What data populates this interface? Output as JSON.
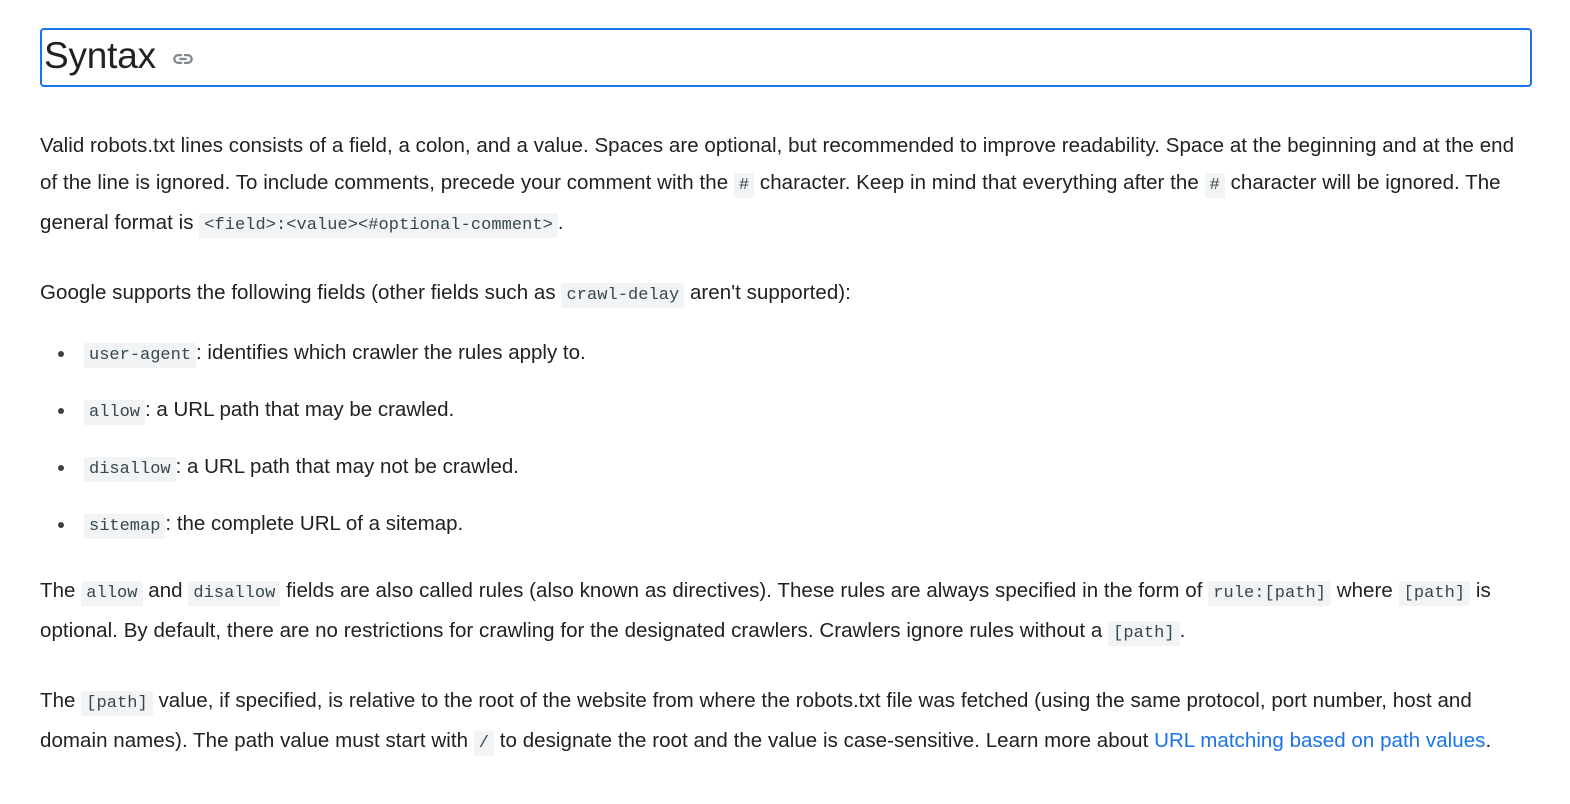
{
  "heading": {
    "title": "Syntax",
    "anchor_icon": "link-icon",
    "focus_border_color": "#1a73e8"
  },
  "paragraphs": {
    "intro": {
      "part1": "Valid robots.txt lines consists of a field, a colon, and a value. Spaces are optional, but recommended to improve readability. Space at the beginning and at the end of the line is ignored. To include comments, precede your comment with the ",
      "code1": "#",
      "part2": " character. Keep in mind that everything after the ",
      "code2": "#",
      "part3": " character will be ignored. The general format is ",
      "code3": "<field>:<value><#optional-comment>",
      "part4": "."
    },
    "fields_intro": {
      "part1": "Google supports the following fields (other fields such as ",
      "code1": "crawl-delay",
      "part2": " aren't supported):"
    },
    "rules": {
      "part1": "The ",
      "code1": "allow",
      "part2": " and ",
      "code2": "disallow",
      "part3": " fields are also called rules (also known as directives). These rules are always specified in the form of ",
      "code3": "rule:[path]",
      "part4": " where ",
      "code4": "[path]",
      "part5": " is optional. By default, there are no restrictions for crawling for the designated crawlers. Crawlers ignore rules without a ",
      "code5": "[path]",
      "part6": "."
    },
    "path_value": {
      "part1": "The ",
      "code1": "[path]",
      "part2": " value, if specified, is relative to the root of the website from where the robots.txt file was fetched (using the same protocol, port number, host and domain names). The path value must start with ",
      "code2": "/",
      "part3": " to designate the root and the value is case-sensitive. Learn more about ",
      "link_text": "URL matching based on path values",
      "part4": "."
    }
  },
  "field_list": [
    {
      "code": "user-agent",
      "desc": ": identifies which crawler the rules apply to."
    },
    {
      "code": "allow",
      "desc": ": a URL path that may be crawled."
    },
    {
      "code": "disallow",
      "desc": ": a URL path that may not be crawled."
    },
    {
      "code": "sitemap",
      "desc": ": the complete URL of a sitemap."
    }
  ],
  "colors": {
    "text": "#202124",
    "link": "#1a73e8",
    "code_bg": "#f1f3f4",
    "code_text": "#37474f",
    "focus_ring": "#1a73e8"
  }
}
